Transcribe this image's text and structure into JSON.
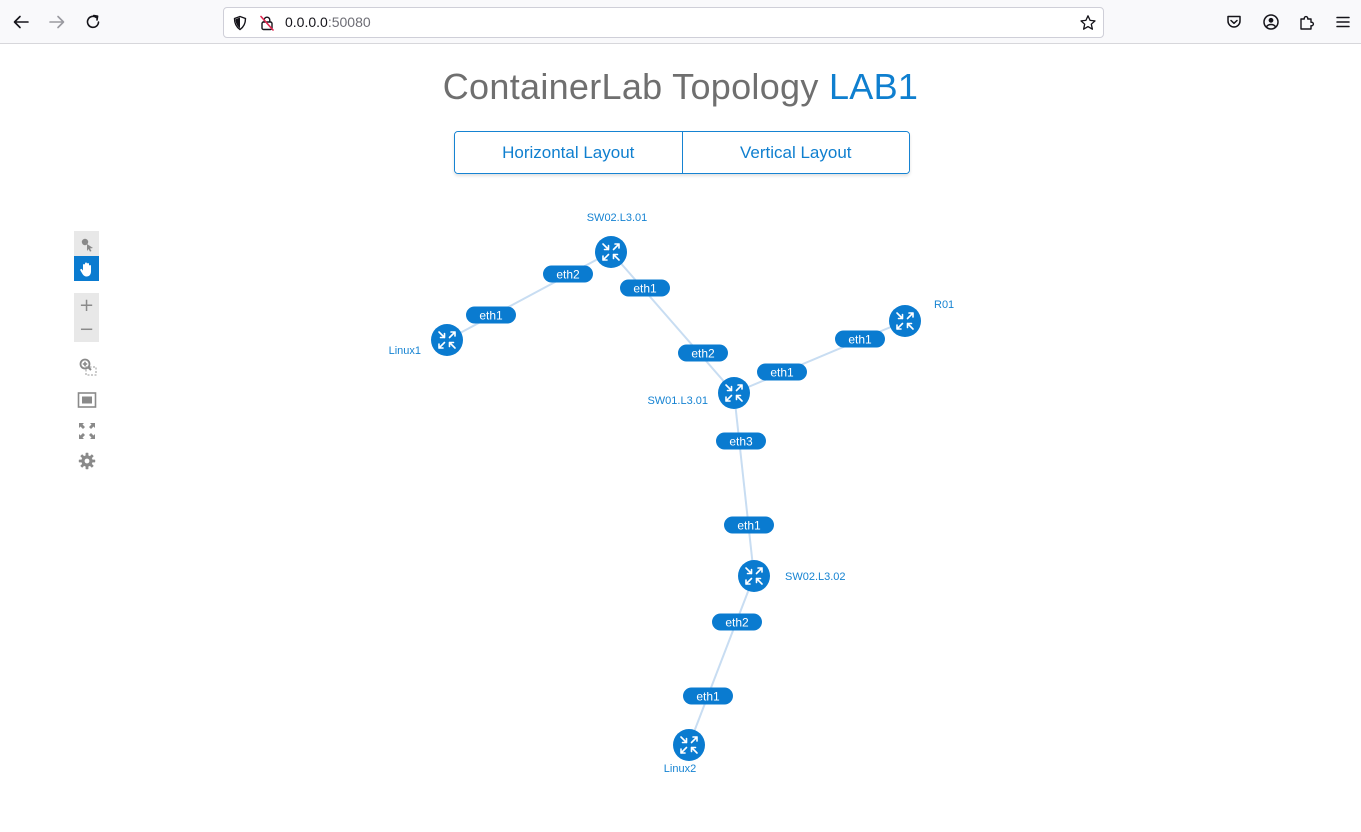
{
  "browser": {
    "url_host": "0.0.0.0",
    "url_port": ":50080"
  },
  "page": {
    "title_main": "ContainerLab Topology ",
    "title_lab": "LAB1",
    "buttons": {
      "horizontal": "Horizontal Layout",
      "vertical": "Vertical Layout"
    }
  },
  "toolbar": {
    "tools": [
      "select-tool",
      "pan-tool",
      "zoom-in",
      "zoom-out",
      "zoom-selection",
      "fit-view",
      "fullscreen",
      "settings"
    ],
    "active": "pan-tool"
  },
  "topology": {
    "colors": {
      "node": "#0a7bd0",
      "link": "#c8ddf2",
      "label": "#1683d2"
    },
    "nodes": [
      {
        "id": "SW02.L3.01",
        "label": "SW02.L3.01"
      },
      {
        "id": "Linux1",
        "label": "Linux1"
      },
      {
        "id": "R01",
        "label": "R01"
      },
      {
        "id": "SW01.L3.01",
        "label": "SW01.L3.01"
      },
      {
        "id": "SW02.L3.02",
        "label": "SW02.L3.02"
      },
      {
        "id": "Linux2",
        "label": "Linux2"
      }
    ],
    "links": [
      {
        "source": "SW02.L3.01",
        "target": "Linux1",
        "source_port": "eth2",
        "target_port": "eth1"
      },
      {
        "source": "SW02.L3.01",
        "target": "SW01.L3.01",
        "source_port": "eth1",
        "target_port": "eth2"
      },
      {
        "source": "R01",
        "target": "SW01.L3.01",
        "source_port": "eth1",
        "target_port": "eth1"
      },
      {
        "source": "SW01.L3.01",
        "target": "SW02.L3.02",
        "source_port": "eth3",
        "target_port": "eth1"
      },
      {
        "source": "SW02.L3.02",
        "target": "Linux2",
        "source_port": "eth2",
        "target_port": "eth1"
      }
    ]
  }
}
